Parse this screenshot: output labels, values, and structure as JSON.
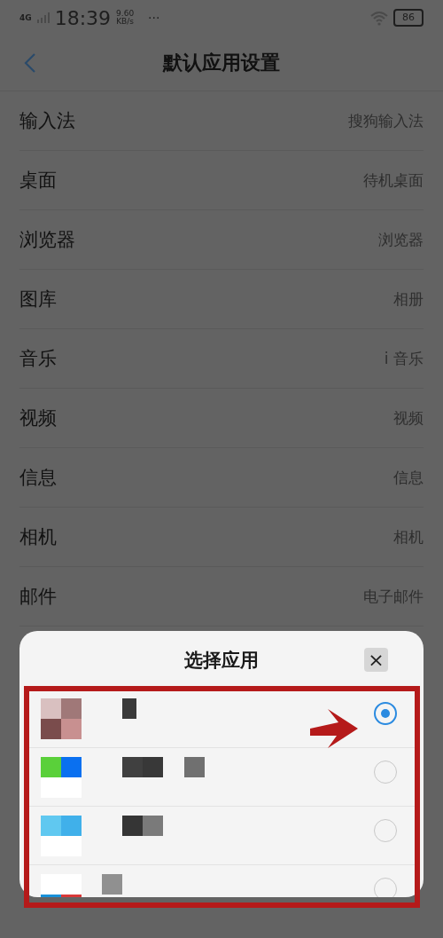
{
  "status_bar": {
    "network": "4G",
    "time": "18:39",
    "speed": "9.60",
    "speed_unit": "KB/s",
    "more": "···",
    "battery": "86"
  },
  "header": {
    "title": "默认应用设置"
  },
  "settings": [
    {
      "label": "输入法",
      "value": "搜狗输入法"
    },
    {
      "label": "桌面",
      "value": "待机桌面"
    },
    {
      "label": "浏览器",
      "value": "浏览器"
    },
    {
      "label": "图库",
      "value": "相册"
    },
    {
      "label": "音乐",
      "value": "i 音乐"
    },
    {
      "label": "视频",
      "value": "视频"
    },
    {
      "label": "信息",
      "value": "信息"
    },
    {
      "label": "相机",
      "value": "相机"
    },
    {
      "label": "邮件",
      "value": "电子邮件"
    }
  ],
  "sheet": {
    "title": "选择应用",
    "close": "×",
    "apps": [
      {
        "selected": true
      },
      {
        "selected": false
      },
      {
        "selected": false
      },
      {
        "selected": false
      }
    ]
  }
}
